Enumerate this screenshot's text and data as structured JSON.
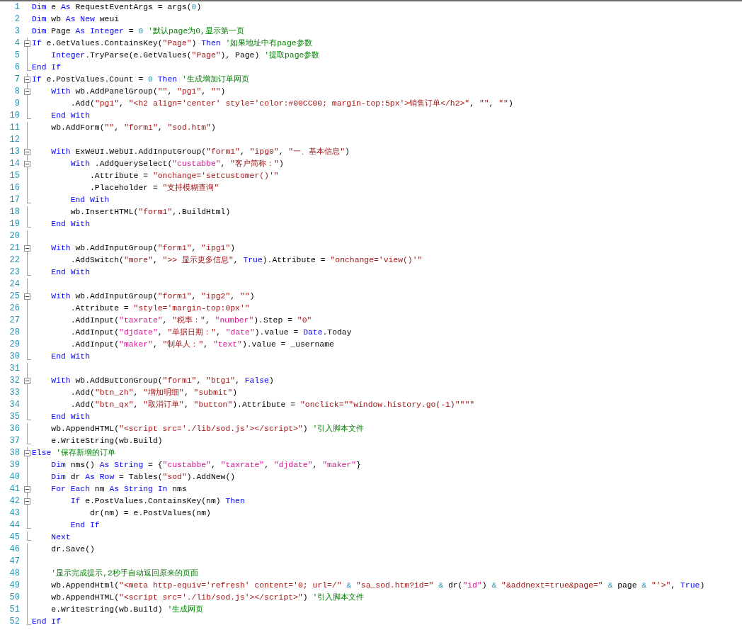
{
  "editor": {
    "lines": [
      {
        "number": "1",
        "kind": "none",
        "tokens": [
          {
            "kind": "keyword",
            "text": "Dim"
          },
          {
            "kind": "plain",
            "text": " e "
          },
          {
            "kind": "keyword",
            "text": "As"
          },
          {
            "kind": "plain",
            "text": " RequestEventArgs = args("
          },
          {
            "kind": "number",
            "text": "0"
          },
          {
            "kind": "plain",
            "text": ")"
          }
        ]
      },
      {
        "number": "2",
        "kind": "none",
        "tokens": [
          {
            "kind": "keyword",
            "text": "Dim"
          },
          {
            "kind": "plain",
            "text": " wb "
          },
          {
            "kind": "keyword",
            "text": "As"
          },
          {
            "kind": "keyword",
            "text": " New"
          },
          {
            "kind": "plain",
            "text": " weui"
          }
        ]
      },
      {
        "number": "3",
        "kind": "none",
        "tokens": [
          {
            "kind": "keyword",
            "text": "Dim"
          },
          {
            "kind": "plain",
            "text": " Page "
          },
          {
            "kind": "keyword",
            "text": "As"
          },
          {
            "kind": "keyword",
            "text": " Integer"
          },
          {
            "kind": "plain",
            "text": " = "
          },
          {
            "kind": "number",
            "text": "0"
          },
          {
            "kind": "comment",
            "text": " '默认page为0,显示第一页"
          }
        ]
      },
      {
        "number": "4",
        "kind": "fold",
        "tokens": [
          {
            "kind": "keyword",
            "text": "If"
          },
          {
            "kind": "plain",
            "text": " e.GetValues.ContainsKey("
          },
          {
            "kind": "string",
            "text": "\"Page\""
          },
          {
            "kind": "plain",
            "text": ") "
          },
          {
            "kind": "keyword",
            "text": "Then"
          },
          {
            "kind": "comment",
            "text": " '如果地址中有page参数"
          }
        ]
      },
      {
        "number": "5",
        "kind": "line",
        "tokens": [
          {
            "kind": "keyword",
            "text": "    Integer"
          },
          {
            "kind": "plain",
            "text": ".TryParse(e.GetValues("
          },
          {
            "kind": "string",
            "text": "\"Page\""
          },
          {
            "kind": "plain",
            "text": "), Page) "
          },
          {
            "kind": "comment",
            "text": "'提取page参数"
          }
        ]
      },
      {
        "number": "6",
        "kind": "end",
        "tokens": [
          {
            "kind": "keyword",
            "text": "End If"
          }
        ]
      },
      {
        "number": "7",
        "kind": "fold",
        "tokens": [
          {
            "kind": "keyword",
            "text": "If"
          },
          {
            "kind": "plain",
            "text": " e.PostValues.Count = "
          },
          {
            "kind": "number",
            "text": "0"
          },
          {
            "kind": "keyword",
            "text": " Then"
          },
          {
            "kind": "comment",
            "text": " '生成增加订单网页"
          }
        ]
      },
      {
        "number": "8",
        "kind": "fold",
        "tokens": [
          {
            "kind": "keyword",
            "text": "    With"
          },
          {
            "kind": "plain",
            "text": " wb.AddPanelGroup("
          },
          {
            "kind": "string",
            "text": "\"\""
          },
          {
            "kind": "plain",
            "text": ", "
          },
          {
            "kind": "string",
            "text": "\"pg1\""
          },
          {
            "kind": "plain",
            "text": ", "
          },
          {
            "kind": "string",
            "text": "\"\""
          },
          {
            "kind": "plain",
            "text": ")"
          }
        ]
      },
      {
        "number": "9",
        "kind": "line",
        "tokens": [
          {
            "kind": "plain",
            "text": "        .Add("
          },
          {
            "kind": "string",
            "text": "\"pg1\""
          },
          {
            "kind": "plain",
            "text": ", "
          },
          {
            "kind": "string",
            "text": "\"<h2 align='center' style='color:#00CC00; margin-top:5px'>销售订单</h2>\""
          },
          {
            "kind": "plain",
            "text": ", "
          },
          {
            "kind": "string",
            "text": "\"\""
          },
          {
            "kind": "plain",
            "text": ", "
          },
          {
            "kind": "string",
            "text": "\"\""
          },
          {
            "kind": "plain",
            "text": ")"
          }
        ]
      },
      {
        "number": "10",
        "kind": "end",
        "tokens": [
          {
            "kind": "keyword",
            "text": "    End With"
          }
        ]
      },
      {
        "number": "11",
        "kind": "line",
        "tokens": [
          {
            "kind": "plain",
            "text": "    wb.AddForm("
          },
          {
            "kind": "string",
            "text": "\"\""
          },
          {
            "kind": "plain",
            "text": ", "
          },
          {
            "kind": "string",
            "text": "\"form1\""
          },
          {
            "kind": "plain",
            "text": ", "
          },
          {
            "kind": "string",
            "text": "\"sod.htm\""
          },
          {
            "kind": "plain",
            "text": ")"
          }
        ]
      },
      {
        "number": "12",
        "kind": "line"
      },
      {
        "number": "13",
        "kind": "fold",
        "tokens": [
          {
            "kind": "keyword",
            "text": "    With"
          },
          {
            "kind": "plain",
            "text": " ExWeUI.WebUI.AddInputGroup("
          },
          {
            "kind": "string",
            "text": "\"form1\""
          },
          {
            "kind": "plain",
            "text": ", "
          },
          {
            "kind": "string",
            "text": "\"ipg0\""
          },
          {
            "kind": "plain",
            "text": ", "
          },
          {
            "kind": "string",
            "text": "\"一、基本信息\""
          },
          {
            "kind": "plain",
            "text": ")"
          }
        ]
      },
      {
        "number": "14",
        "kind": "fold",
        "tokens": [
          {
            "kind": "keyword",
            "text": "        With"
          },
          {
            "kind": "plain",
            "text": " .AddQuerySelect("
          },
          {
            "kind": "name",
            "text": "\"custabbe\""
          },
          {
            "kind": "plain",
            "text": ", "
          },
          {
            "kind": "string",
            "text": "\"客户简称：\""
          },
          {
            "kind": "plain",
            "text": ")"
          }
        ]
      },
      {
        "number": "15",
        "kind": "line",
        "tokens": [
          {
            "kind": "plain",
            "text": "            .Attribute = "
          },
          {
            "kind": "string",
            "text": "\"onchange='setcustomer()'\""
          }
        ]
      },
      {
        "number": "16",
        "kind": "line",
        "tokens": [
          {
            "kind": "plain",
            "text": "            .Placeholder = "
          },
          {
            "kind": "string",
            "text": "\"支持模糊查询\""
          }
        ]
      },
      {
        "number": "17",
        "kind": "end",
        "tokens": [
          {
            "kind": "keyword",
            "text": "        End With"
          }
        ]
      },
      {
        "number": "18",
        "kind": "line",
        "tokens": [
          {
            "kind": "plain",
            "text": "        wb.InsertHTML("
          },
          {
            "kind": "string",
            "text": "\"form1\""
          },
          {
            "kind": "plain",
            "text": ",.BuildHtml)"
          }
        ]
      },
      {
        "number": "19",
        "kind": "end",
        "tokens": [
          {
            "kind": "keyword",
            "text": "    End With"
          }
        ]
      },
      {
        "number": "20",
        "kind": "line"
      },
      {
        "number": "21",
        "kind": "fold",
        "tokens": [
          {
            "kind": "keyword",
            "text": "    With"
          },
          {
            "kind": "plain",
            "text": " wb.AddInputGroup("
          },
          {
            "kind": "string",
            "text": "\"form1\""
          },
          {
            "kind": "plain",
            "text": ", "
          },
          {
            "kind": "string",
            "text": "\"ipg1\""
          },
          {
            "kind": "plain",
            "text": ")"
          }
        ]
      },
      {
        "number": "22",
        "kind": "line",
        "tokens": [
          {
            "kind": "plain",
            "text": "        .AddSwitch("
          },
          {
            "kind": "string",
            "text": "\"more\""
          },
          {
            "kind": "plain",
            "text": ", "
          },
          {
            "kind": "string",
            "text": "\">> 显示更多信息\""
          },
          {
            "kind": "plain",
            "text": ", "
          },
          {
            "kind": "keyword",
            "text": "True"
          },
          {
            "kind": "plain",
            "text": ").Attribute = "
          },
          {
            "kind": "string",
            "text": "\"onchange='view()'\""
          }
        ]
      },
      {
        "number": "23",
        "kind": "end",
        "tokens": [
          {
            "kind": "keyword",
            "text": "    End With"
          }
        ]
      },
      {
        "number": "24",
        "kind": "line"
      },
      {
        "number": "25",
        "kind": "fold",
        "tokens": [
          {
            "kind": "keyword",
            "text": "    With"
          },
          {
            "kind": "plain",
            "text": " wb.AddInputGroup("
          },
          {
            "kind": "string",
            "text": "\"form1\""
          },
          {
            "kind": "plain",
            "text": ", "
          },
          {
            "kind": "string",
            "text": "\"ipg2\""
          },
          {
            "kind": "plain",
            "text": ", "
          },
          {
            "kind": "string",
            "text": "\"\""
          },
          {
            "kind": "plain",
            "text": ")"
          }
        ]
      },
      {
        "number": "26",
        "kind": "line",
        "tokens": [
          {
            "kind": "plain",
            "text": "        .Attribute = "
          },
          {
            "kind": "string",
            "text": "\"style='margin-top:0px'\""
          }
        ]
      },
      {
        "number": "27",
        "kind": "line",
        "tokens": [
          {
            "kind": "plain",
            "text": "        .AddInput("
          },
          {
            "kind": "name",
            "text": "\"taxrate\""
          },
          {
            "kind": "plain",
            "text": ", "
          },
          {
            "kind": "string",
            "text": "\"税率：\""
          },
          {
            "kind": "plain",
            "text": ", "
          },
          {
            "kind": "name",
            "text": "\"number\""
          },
          {
            "kind": "plain",
            "text": ").Step = "
          },
          {
            "kind": "string",
            "text": "\"0\""
          }
        ]
      },
      {
        "number": "28",
        "kind": "line",
        "tokens": [
          {
            "kind": "plain",
            "text": "        .AddInput("
          },
          {
            "kind": "name",
            "text": "\"djdate\""
          },
          {
            "kind": "plain",
            "text": ", "
          },
          {
            "kind": "string",
            "text": "\"单据日期：\""
          },
          {
            "kind": "plain",
            "text": ", "
          },
          {
            "kind": "name",
            "text": "\"date\""
          },
          {
            "kind": "plain",
            "text": ").value = "
          },
          {
            "kind": "keyword",
            "text": "Date"
          },
          {
            "kind": "plain",
            "text": ".Today"
          }
        ]
      },
      {
        "number": "29",
        "kind": "line",
        "tokens": [
          {
            "kind": "plain",
            "text": "        .AddInput("
          },
          {
            "kind": "name",
            "text": "\"maker\""
          },
          {
            "kind": "plain",
            "text": ", "
          },
          {
            "kind": "string",
            "text": "\"制单人：\""
          },
          {
            "kind": "plain",
            "text": ", "
          },
          {
            "kind": "name",
            "text": "\"text\""
          },
          {
            "kind": "plain",
            "text": ").value = _username"
          }
        ]
      },
      {
        "number": "30",
        "kind": "end",
        "tokens": [
          {
            "kind": "keyword",
            "text": "    End With"
          }
        ]
      },
      {
        "number": "31",
        "kind": "line"
      },
      {
        "number": "32",
        "kind": "fold",
        "tokens": [
          {
            "kind": "keyword",
            "text": "    With"
          },
          {
            "kind": "plain",
            "text": " wb.AddButtonGroup("
          },
          {
            "kind": "string",
            "text": "\"form1\""
          },
          {
            "kind": "plain",
            "text": ", "
          },
          {
            "kind": "string",
            "text": "\"btg1\""
          },
          {
            "kind": "plain",
            "text": ", "
          },
          {
            "kind": "keyword",
            "text": "False"
          },
          {
            "kind": "plain",
            "text": ")"
          }
        ]
      },
      {
        "number": "33",
        "kind": "line",
        "tokens": [
          {
            "kind": "plain",
            "text": "        .Add("
          },
          {
            "kind": "string",
            "text": "\"btn_zh\""
          },
          {
            "kind": "plain",
            "text": ", "
          },
          {
            "kind": "string",
            "text": "\"增加明细\""
          },
          {
            "kind": "plain",
            "text": ", "
          },
          {
            "kind": "string",
            "text": "\"submit\""
          },
          {
            "kind": "plain",
            "text": ")"
          }
        ]
      },
      {
        "number": "34",
        "kind": "line",
        "tokens": [
          {
            "kind": "plain",
            "text": "        .Add("
          },
          {
            "kind": "string",
            "text": "\"btn_qx\""
          },
          {
            "kind": "plain",
            "text": ", "
          },
          {
            "kind": "string",
            "text": "\"取消订单\""
          },
          {
            "kind": "plain",
            "text": ", "
          },
          {
            "kind": "string",
            "text": "\"button\""
          },
          {
            "kind": "plain",
            "text": ").Attribute = "
          },
          {
            "kind": "string",
            "text": "\"onclick=\"\"window.history.go(-1)\"\"\"\""
          }
        ]
      },
      {
        "number": "35",
        "kind": "end",
        "tokens": [
          {
            "kind": "keyword",
            "text": "    End With"
          }
        ]
      },
      {
        "number": "36",
        "kind": "line",
        "tokens": [
          {
            "kind": "plain",
            "text": "    wb.AppendHTML("
          },
          {
            "kind": "string",
            "text": "\"<script src='./lib/sod.js'></script>\""
          },
          {
            "kind": "plain",
            "text": ") "
          },
          {
            "kind": "comment",
            "text": "'引入脚本文件"
          }
        ]
      },
      {
        "number": "37",
        "kind": "end",
        "tokens": [
          {
            "kind": "plain",
            "text": "    e.WriteString(wb.Build)"
          }
        ]
      },
      {
        "number": "38",
        "kind": "fold",
        "tokens": [
          {
            "kind": "keyword",
            "text": "Else"
          },
          {
            "kind": "comment",
            "text": " '保存新增的订单"
          }
        ]
      },
      {
        "number": "39",
        "kind": "line",
        "tokens": [
          {
            "kind": "keyword",
            "text": "    Dim"
          },
          {
            "kind": "plain",
            "text": " nms() "
          },
          {
            "kind": "keyword",
            "text": "As"
          },
          {
            "kind": "keyword",
            "text": " String"
          },
          {
            "kind": "plain",
            "text": " = {"
          },
          {
            "kind": "name",
            "text": "\"custabbe\""
          },
          {
            "kind": "plain",
            "text": ", "
          },
          {
            "kind": "name",
            "text": "\"taxrate\""
          },
          {
            "kind": "plain",
            "text": ", "
          },
          {
            "kind": "name",
            "text": "\"djdate\""
          },
          {
            "kind": "plain",
            "text": ", "
          },
          {
            "kind": "name",
            "text": "\"maker\""
          },
          {
            "kind": "plain",
            "text": "}"
          }
        ]
      },
      {
        "number": "40",
        "kind": "line",
        "tokens": [
          {
            "kind": "keyword",
            "text": "    Dim"
          },
          {
            "kind": "plain",
            "text": " dr "
          },
          {
            "kind": "keyword",
            "text": "As"
          },
          {
            "kind": "keyword",
            "text": " Row"
          },
          {
            "kind": "plain",
            "text": " = Tables("
          },
          {
            "kind": "string",
            "text": "\"sod\""
          },
          {
            "kind": "plain",
            "text": ").AddNew()"
          }
        ]
      },
      {
        "number": "41",
        "kind": "fold",
        "tokens": [
          {
            "kind": "keyword",
            "text": "    For Each"
          },
          {
            "kind": "plain",
            "text": " nm "
          },
          {
            "kind": "keyword",
            "text": "As"
          },
          {
            "kind": "keyword",
            "text": " String"
          },
          {
            "kind": "keyword",
            "text": " In"
          },
          {
            "kind": "plain",
            "text": " nms"
          }
        ]
      },
      {
        "number": "42",
        "kind": "fold",
        "tokens": [
          {
            "kind": "keyword",
            "text": "        If"
          },
          {
            "kind": "plain",
            "text": " e.PostValues.ContainsKey(nm) "
          },
          {
            "kind": "keyword",
            "text": "Then"
          }
        ]
      },
      {
        "number": "43",
        "kind": "line",
        "tokens": [
          {
            "kind": "plain",
            "text": "            dr(nm) = e.PostValues(nm)"
          }
        ]
      },
      {
        "number": "44",
        "kind": "end",
        "tokens": [
          {
            "kind": "keyword",
            "text": "        End If"
          }
        ]
      },
      {
        "number": "45",
        "kind": "end",
        "tokens": [
          {
            "kind": "keyword",
            "text": "    Next"
          }
        ]
      },
      {
        "number": "46",
        "kind": "line",
        "tokens": [
          {
            "kind": "plain",
            "text": "    dr.Save()"
          }
        ]
      },
      {
        "number": "47",
        "kind": "line"
      },
      {
        "number": "48",
        "kind": "line",
        "tokens": [
          {
            "kind": "comment",
            "text": "    '显示完成提示,2秒手自动返回原来的页面"
          }
        ]
      },
      {
        "number": "49",
        "kind": "line",
        "tokens": [
          {
            "kind": "plain",
            "text": "    wb.AppendHtml("
          },
          {
            "kind": "string",
            "text": "\"<meta http-equiv='refresh' content='0; url=/\""
          },
          {
            "kind": "number",
            "text": " &"
          },
          {
            "kind": "string",
            "text": " \"sa_sod.htm?id=\""
          },
          {
            "kind": "number",
            "text": " &"
          },
          {
            "kind": "plain",
            "text": " dr("
          },
          {
            "kind": "name",
            "text": "\"id\""
          },
          {
            "kind": "plain",
            "text": ") "
          },
          {
            "kind": "number",
            "text": "&"
          },
          {
            "kind": "string",
            "text": " \"&addnext=true&page=\""
          },
          {
            "kind": "number",
            "text": " &"
          },
          {
            "kind": "plain",
            "text": " page "
          },
          {
            "kind": "number",
            "text": "&"
          },
          {
            "kind": "string",
            "text": " \"'>\""
          },
          {
            "kind": "plain",
            "text": ", "
          },
          {
            "kind": "keyword",
            "text": "True"
          },
          {
            "kind": "plain",
            "text": ")"
          }
        ]
      },
      {
        "number": "50",
        "kind": "line",
        "tokens": [
          {
            "kind": "plain",
            "text": "    wb.AppendHTML("
          },
          {
            "kind": "string",
            "text": "\"<script src='./lib/sod.js'></script>\""
          },
          {
            "kind": "plain",
            "text": ") "
          },
          {
            "kind": "comment",
            "text": "'引入脚本文件"
          }
        ]
      },
      {
        "number": "51",
        "kind": "line",
        "tokens": [
          {
            "kind": "plain",
            "text": "    e.WriteString(wb.Build) "
          },
          {
            "kind": "comment",
            "text": "'生成网页"
          }
        ]
      },
      {
        "number": "52",
        "kind": "end",
        "tokens": [
          {
            "kind": "keyword",
            "text": "End If"
          }
        ]
      }
    ]
  }
}
